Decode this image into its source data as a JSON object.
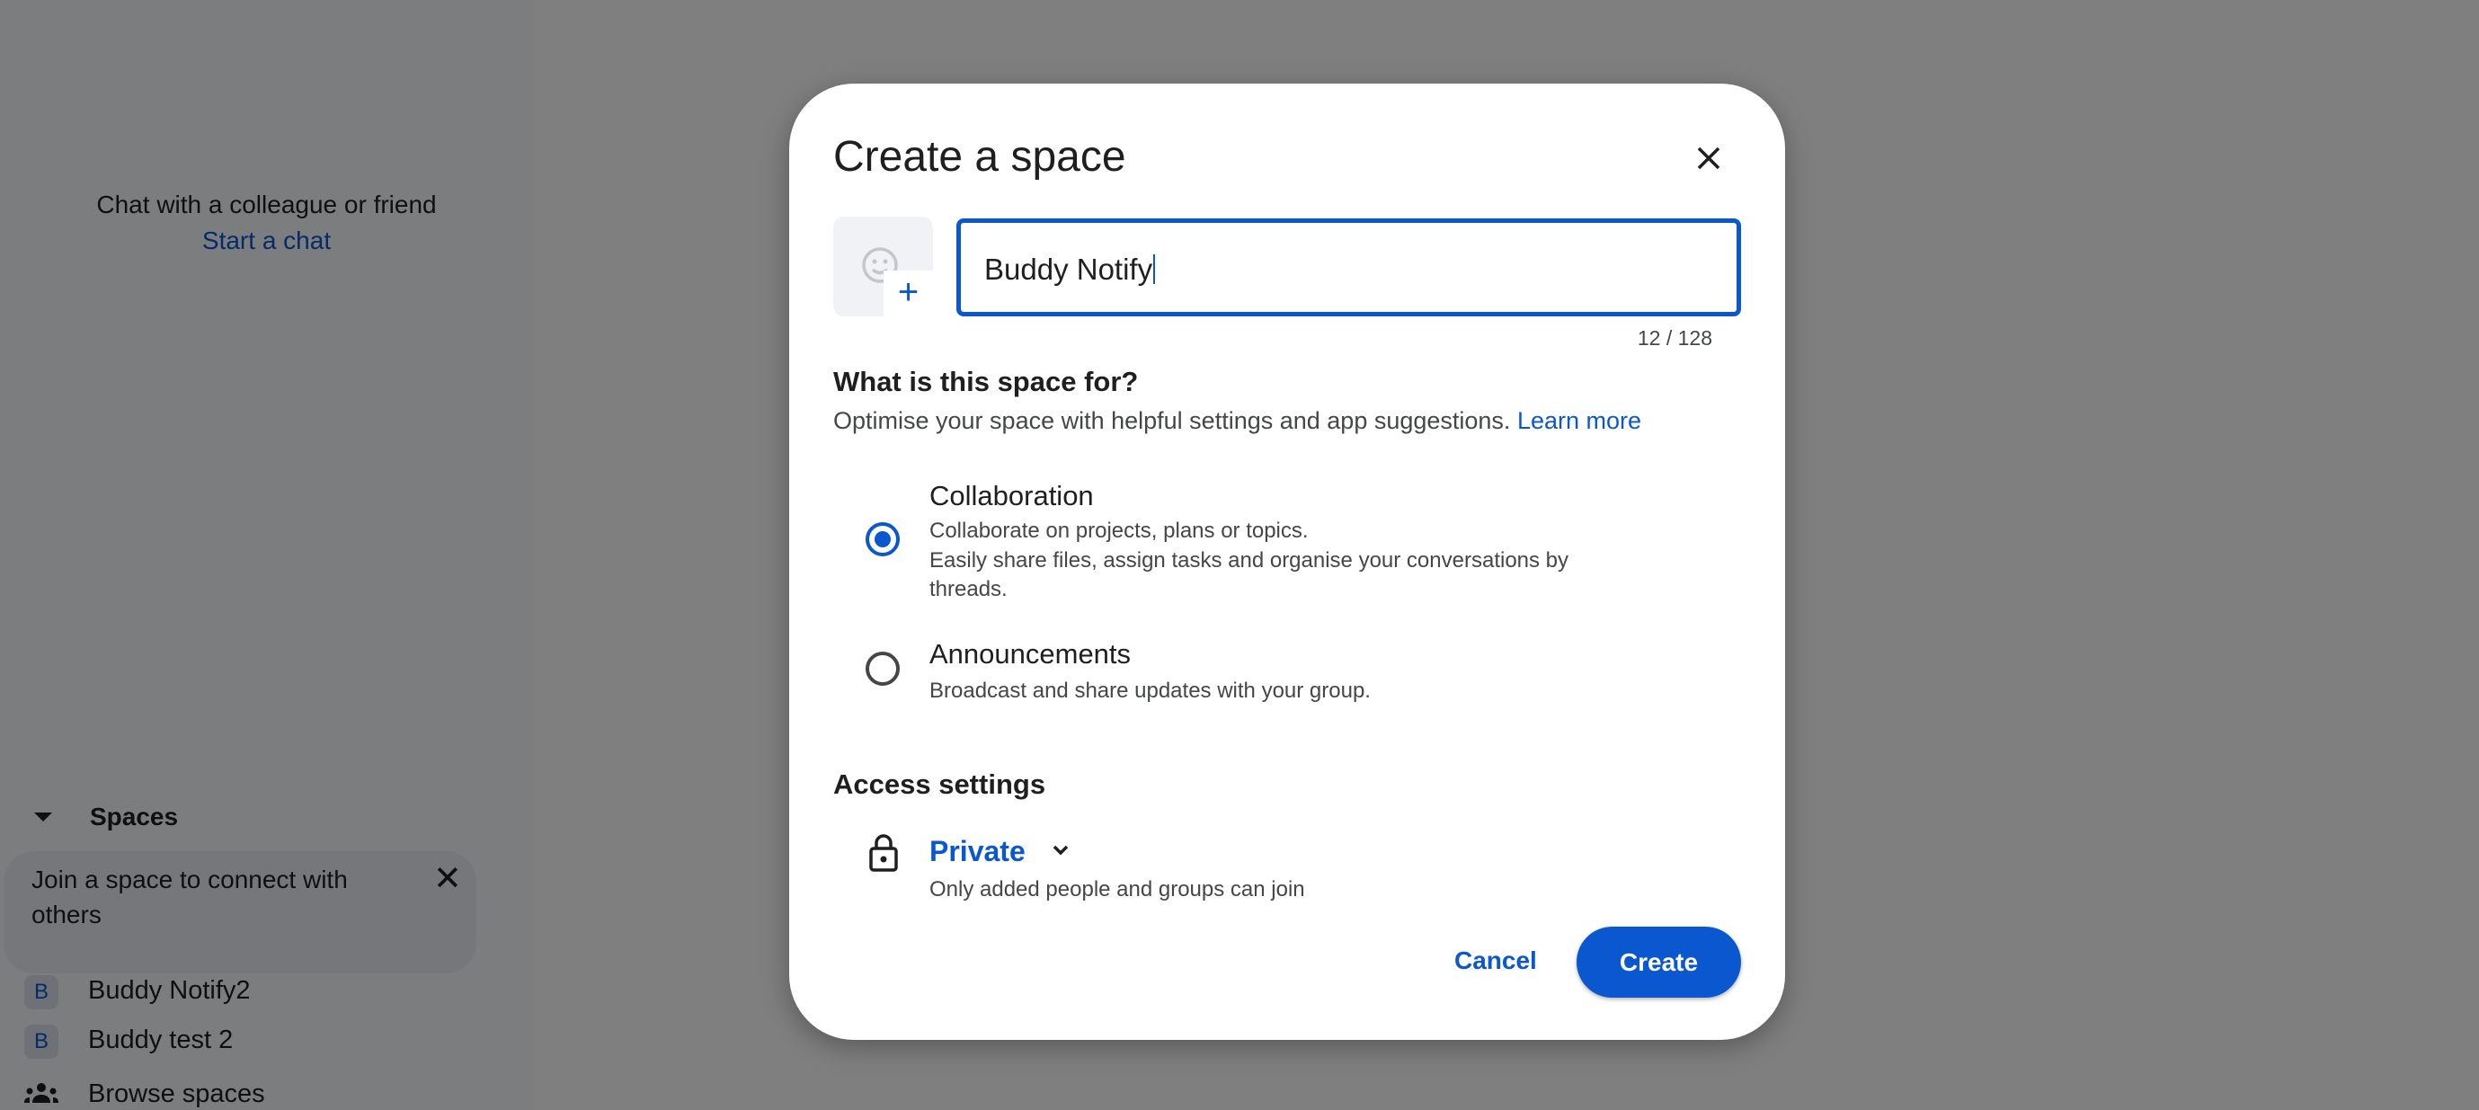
{
  "sidebar": {
    "empty_chat_text": "Chat with a colleague or friend",
    "start_chat_link": "Start a chat",
    "spaces_header": "Spaces",
    "join_card_text_line1": "Join a space to connect with",
    "join_card_text_line2": "others",
    "spaces": [
      {
        "initial": "B",
        "name": "Buddy Notify2"
      },
      {
        "initial": "B",
        "name": "Buddy test 2"
      }
    ],
    "browse_spaces": "Browse spaces"
  },
  "dialog": {
    "title": "Create a space",
    "name_input_value": "Buddy Notify",
    "char_counter": "12 / 128",
    "purpose_heading": "What is this space for?",
    "purpose_subtitle": "Optimise your space with helpful settings and app suggestions.",
    "learn_more": "Learn more",
    "options": [
      {
        "label": "Collaboration",
        "desc": [
          "Collaborate on projects, plans or topics.",
          "Easily share files, assign tasks and organise your conversations by",
          "threads."
        ],
        "selected": true
      },
      {
        "label": "Announcements",
        "desc": [
          "Broadcast and share updates with your group."
        ],
        "selected": false
      }
    ],
    "access_heading": "Access settings",
    "access_value": "Private",
    "access_desc": "Only added people and groups can join",
    "cancel": "Cancel",
    "create": "Create"
  },
  "colors": {
    "accent": "#0b57d0",
    "overlay": "rgba(0,0,0,0.5)"
  }
}
